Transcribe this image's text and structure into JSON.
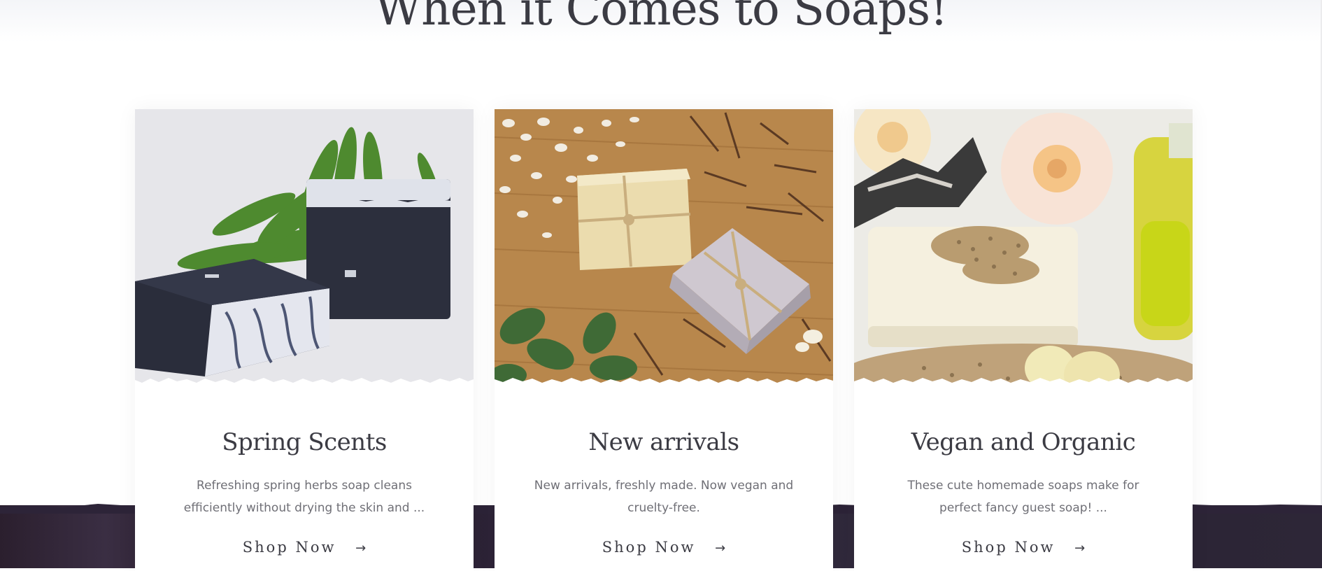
{
  "section": {
    "title": "When it Comes to Soaps!"
  },
  "cards": [
    {
      "title": "Spring Scents",
      "description": "Refreshing  spring herbs soap cleans efficiently without drying the skin and ...",
      "cta_label": "Shop Now",
      "image_subject": "charcoal swirl soap bars with green leaf"
    },
    {
      "title": "New arrivals",
      "description": "New arrivals, freshly made. Now vegan and cruelty-free.",
      "cta_label": "Shop Now",
      "image_subject": "twine-tied soap bars on wooden board with oats and herbs"
    },
    {
      "title": "Vegan and Organic",
      "description": "These cute homemade soaps make for perfect fancy guest soap! ...",
      "cta_label": "Shop Now",
      "image_subject": "cream soap bar with sesame seeds, roses and oil bottle"
    }
  ],
  "icons": {
    "cta_arrow": "arrow-right-icon"
  },
  "colors": {
    "heading": "#3b3b43",
    "body_text": "#6f6f76",
    "dark_band": "#2d2438"
  }
}
